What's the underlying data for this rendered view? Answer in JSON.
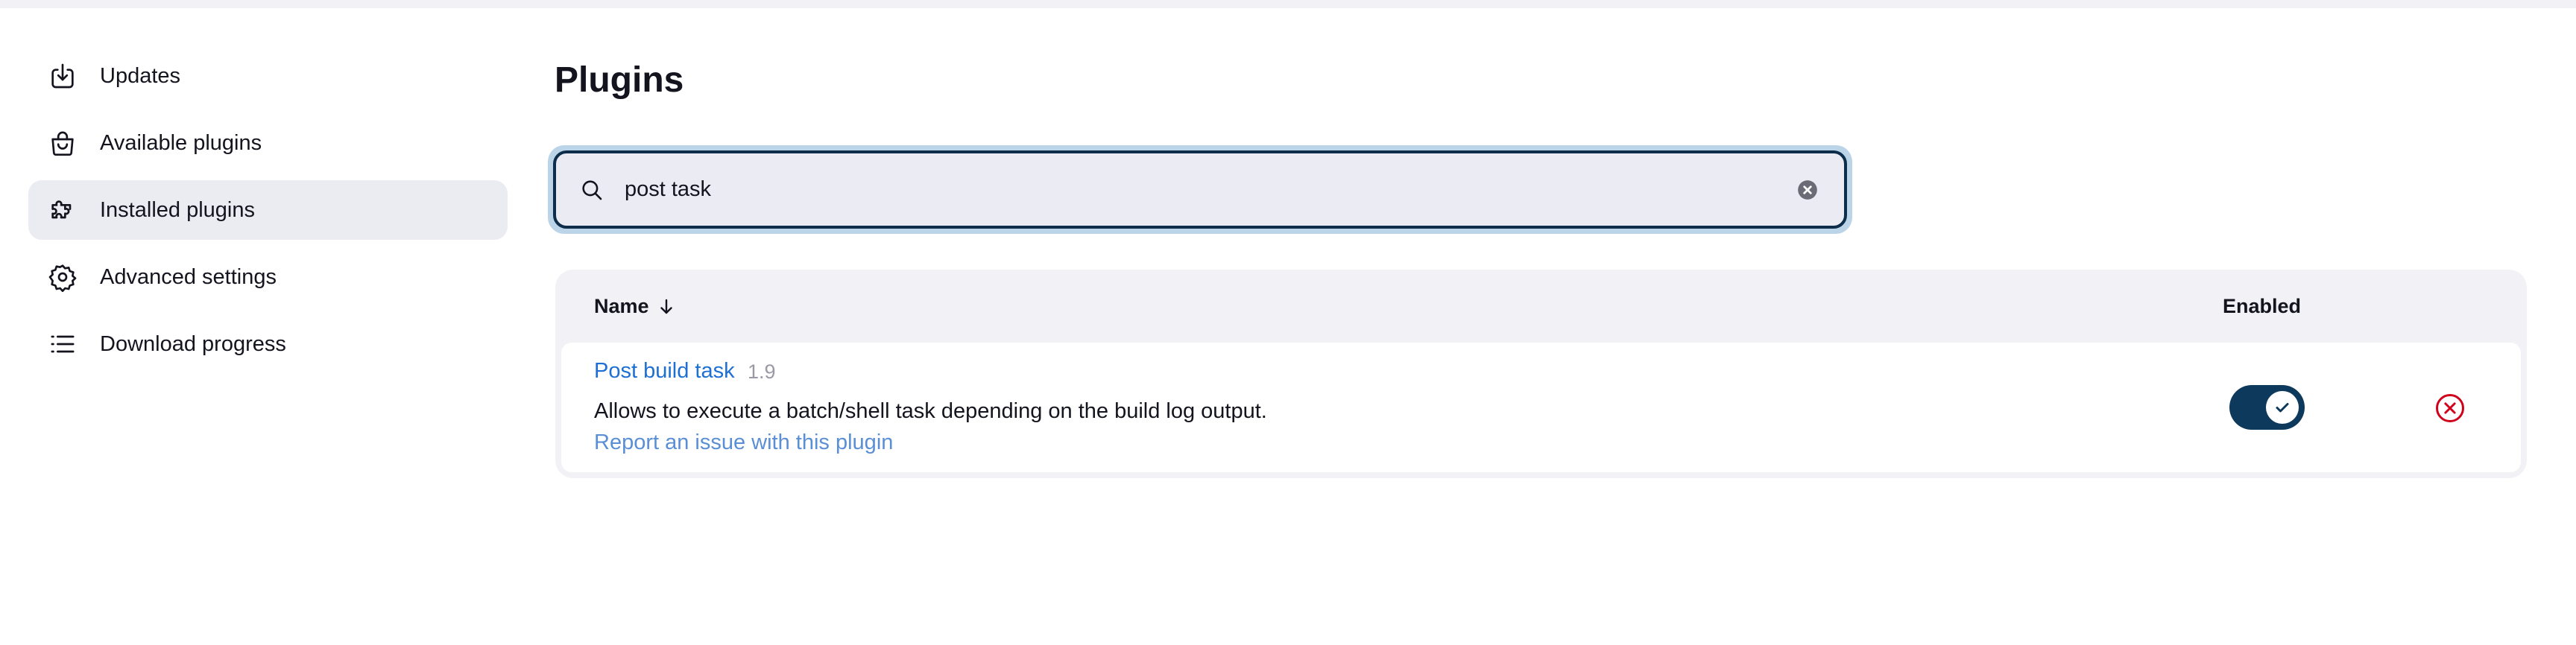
{
  "sidebar": {
    "items": [
      {
        "label": "Updates",
        "icon": "download-icon",
        "active": false
      },
      {
        "label": "Available plugins",
        "icon": "shopping-bag-icon",
        "active": false
      },
      {
        "label": "Installed plugins",
        "icon": "puzzle-icon",
        "active": true
      },
      {
        "label": "Advanced settings",
        "icon": "gear-icon",
        "active": false
      },
      {
        "label": "Download progress",
        "icon": "list-icon",
        "active": false
      }
    ]
  },
  "main": {
    "title": "Plugins",
    "search": {
      "value": "post task",
      "placeholder": ""
    },
    "table": {
      "columns": {
        "name": "Name",
        "enabled": "Enabled"
      },
      "rows": [
        {
          "name": "Post build task",
          "version": "1.9",
          "description": "Allows to execute a batch/shell task depending on the build log output.",
          "report_link": "Report an issue with this plugin",
          "enabled": true
        }
      ]
    }
  },
  "colors": {
    "accent": "#0d3a5c",
    "link": "#1d6fd1",
    "danger": "#d0021b",
    "active_bg": "#ebebf2"
  }
}
